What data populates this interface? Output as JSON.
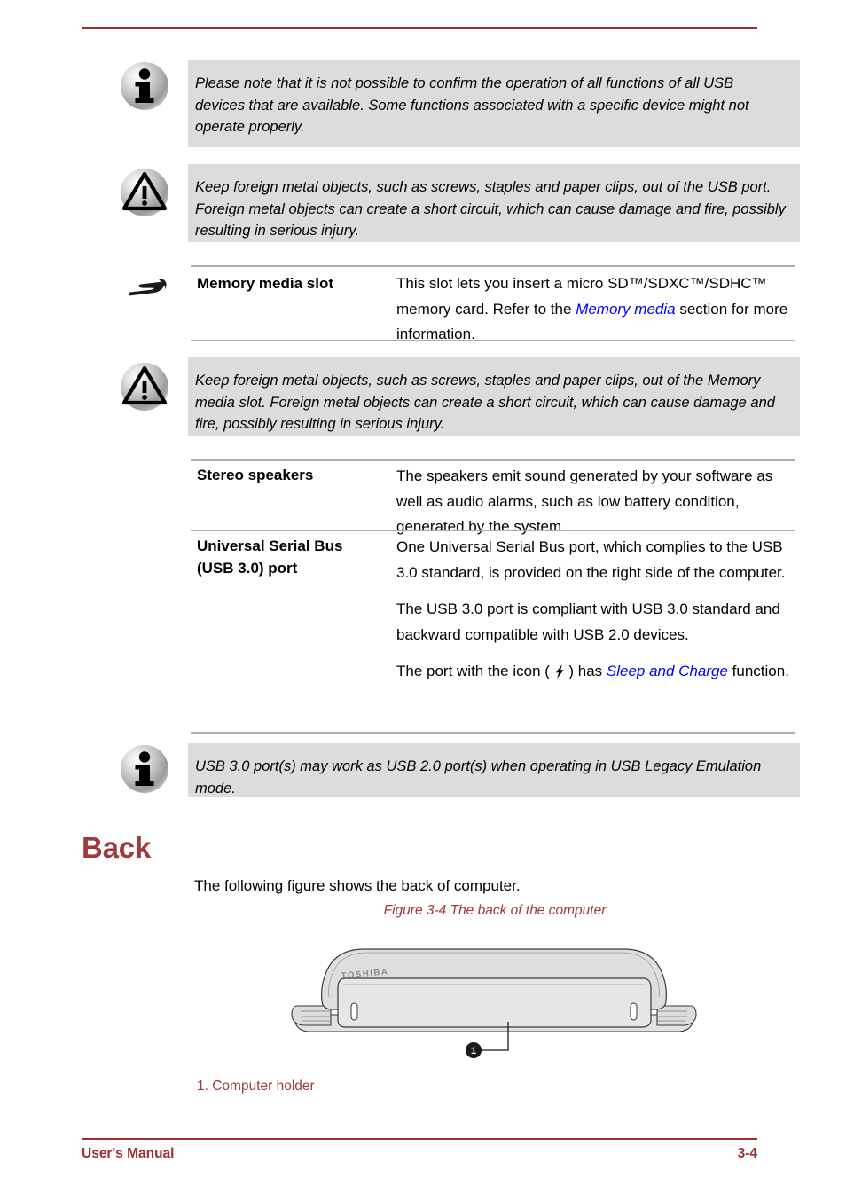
{
  "document": {
    "header_rule_color": "#9E2D2D",
    "callout_bg": "#DCDCDC",
    "link_color": "#0000FF",
    "accent_color": "#A03A3A"
  },
  "notes": {
    "usb_devices_note": "Please note that it is not possible to confirm the operation of all functions of all USB devices that are available. Some functions associated with a specific device might not operate properly.",
    "usb_port_caution": "Keep foreign metal objects, such as screws, staples and paper clips, out of the USB port. Foreign metal objects can create a short circuit, which can cause damage and fire, possibly resulting in serious injury.",
    "memory_slot_caution": "Keep foreign metal objects, such as screws, staples and paper clips, out of the Memory media slot. Foreign metal objects can create a short circuit, which can cause damage and fire, possibly resulting in serious injury.",
    "usb_legacy_note": "USB 3.0 port(s) may work as USB 2.0 port(s) when operating in USB Legacy Emulation mode."
  },
  "spec_table": {
    "memory_media_slot": {
      "name": "Memory media slot",
      "desc_part1": "This slot lets you insert a micro SD™/SDXC™/SDHC™ memory card. Refer to the ",
      "link": "Memory media",
      "desc_part2": " section for more information."
    },
    "stereo_speakers": {
      "name": "Stereo speakers",
      "desc": "The speakers emit sound generated by your software as well as audio alarms, such as low battery condition, generated by the system."
    },
    "usb_port": {
      "name_line1": "Universal Serial Bus",
      "name_line2": "(USB 3.0) port",
      "desc_p1": "One Universal Serial Bus port, which complies to the USB 3.0 standard, is provided on the right side of the computer.",
      "desc_p2": "The USB 3.0 port is compliant with USB 3.0 standard and backward compatible with USB 2.0 devices.",
      "desc_p3_before": "The port with the icon ( ",
      "desc_p3_icon": "⚡",
      "desc_p3_mid": " ) has ",
      "desc_p3_link": "Sleep and Charge",
      "desc_p3_after": " function."
    }
  },
  "back_section": {
    "heading": "Back",
    "intro": "The following figure shows the back of computer.",
    "figure_caption": "Figure 3-4 The back of the computer",
    "callout_number": "1",
    "legend": "1. Computer holder",
    "brand_on_lid": "TOSHIBA"
  },
  "footer": {
    "left": "User's Manual",
    "right": "3-4"
  },
  "icons": {
    "note": "info-icon",
    "caution": "warning-triangle-icon",
    "memory": "sd-card-icon",
    "sleep_charge": "lightning-bolt-icon"
  }
}
